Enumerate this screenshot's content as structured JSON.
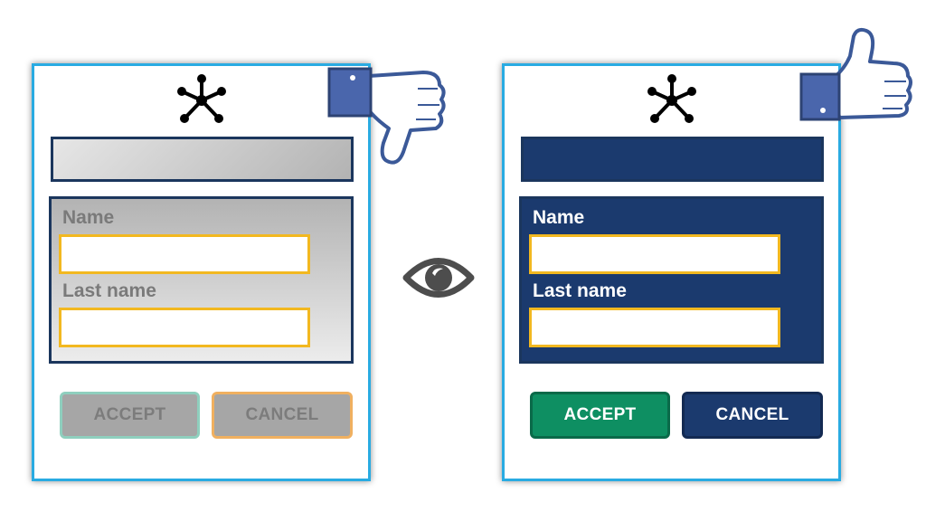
{
  "panels": {
    "bad": {
      "form": {
        "name_label": "Name",
        "last_name_label": "Last name"
      },
      "buttons": {
        "accept": "ACCEPT",
        "cancel": "CANCEL"
      }
    },
    "good": {
      "form": {
        "name_label": "Name",
        "last_name_label": "Last name"
      },
      "buttons": {
        "accept": "ACCEPT",
        "cancel": "CANCEL"
      }
    }
  },
  "icons": {
    "logo": "network-node-icon",
    "left_rating": "thumbs-down-icon",
    "right_rating": "thumbs-up-icon",
    "center": "eye-icon"
  },
  "colors": {
    "panel_border": "#29abe2",
    "navy": "#1b3a6e",
    "field_border": "#f2b820",
    "accept_green": "#0e8f62",
    "disabled_gray": "#a6a6a6"
  }
}
